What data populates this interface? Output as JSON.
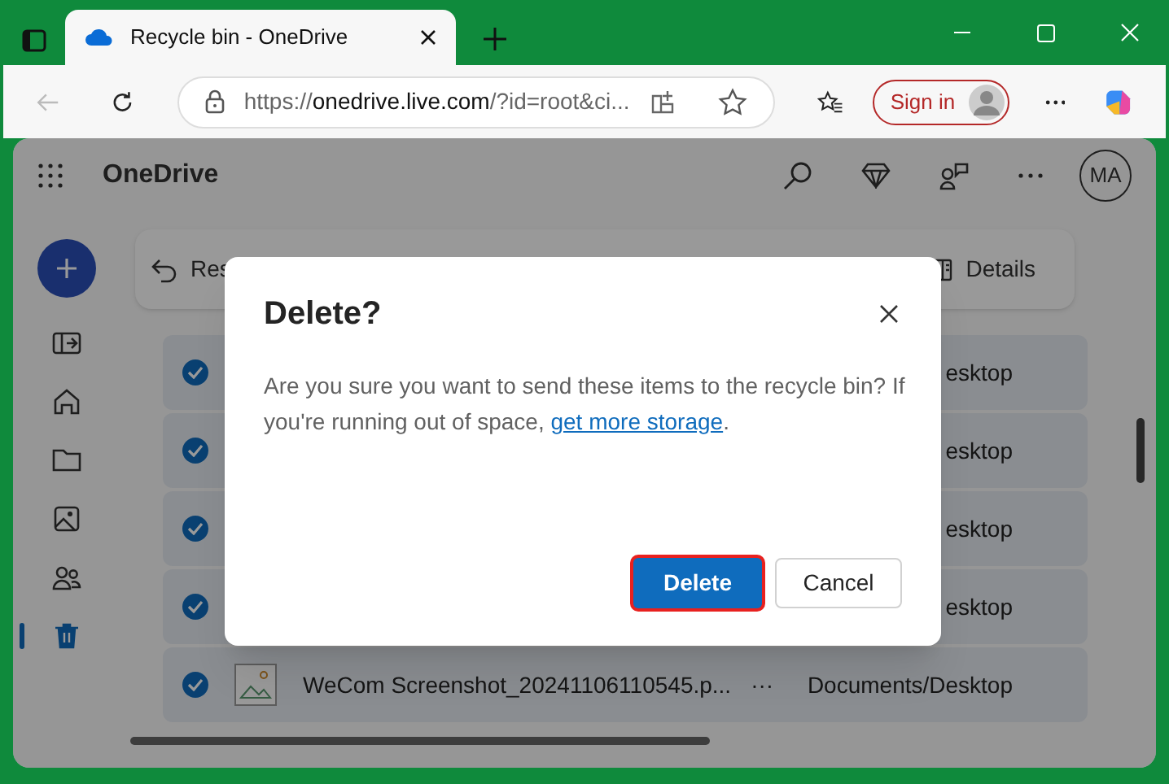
{
  "browser": {
    "tab_title": "Recycle bin - OneDrive",
    "url_scheme": "https://",
    "url_host": "onedrive.live.com",
    "url_rest": "/?id=root&ci...",
    "sign_in": "Sign in"
  },
  "app": {
    "title": "OneDrive",
    "avatar": "MA",
    "sidebar": [
      {
        "kind": "collapse",
        "selected": false
      },
      {
        "kind": "home",
        "selected": false
      },
      {
        "kind": "folder",
        "selected": false
      },
      {
        "kind": "photo",
        "selected": false
      },
      {
        "kind": "people",
        "selected": false
      },
      {
        "kind": "trash",
        "selected": true
      }
    ],
    "command_bar": {
      "restore": "Res",
      "details": "Details"
    },
    "rows": [
      {
        "checked": true,
        "location": "esktop"
      },
      {
        "checked": true,
        "location": "esktop"
      },
      {
        "checked": true,
        "location": "esktop"
      },
      {
        "checked": true,
        "location": "esktop"
      },
      {
        "checked": true,
        "name": "WeCom Screenshot_20241106110545.p...",
        "more": "···",
        "location": "Documents/Desktop"
      }
    ]
  },
  "dialog": {
    "title": "Delete?",
    "body_before": "Are you sure you want to send these items to the recycle bin? If you're running out of space, ",
    "link": "get more storage",
    "body_after": ".",
    "primary": "Delete",
    "secondary": "Cancel"
  }
}
